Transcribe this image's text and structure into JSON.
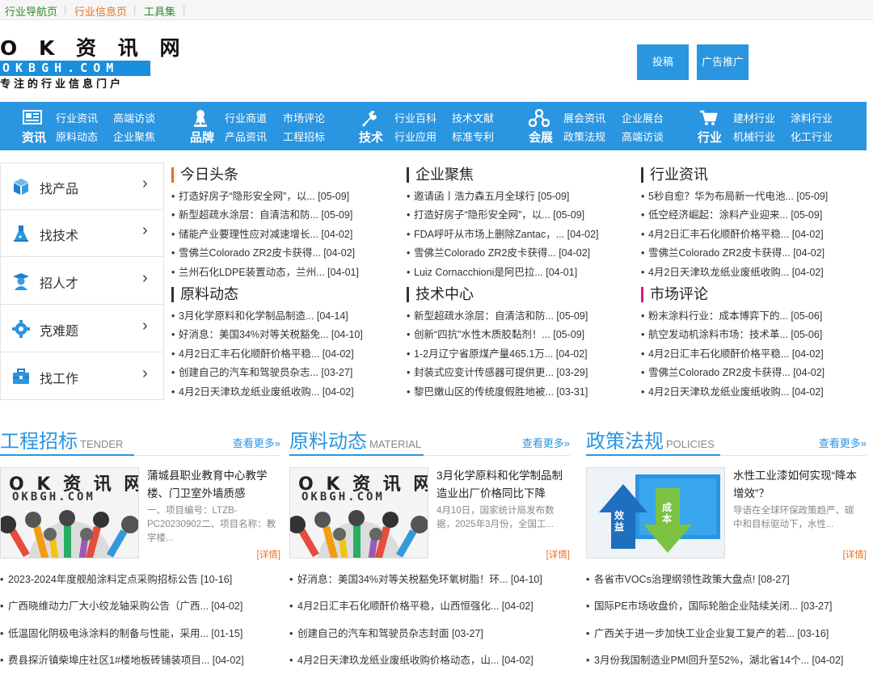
{
  "topbar": {
    "links": [
      "行业导航页",
      "行业信息页",
      "工具集"
    ]
  },
  "logo": {
    "line1": "O K 资 讯 网",
    "line2": "OKBGH.COM",
    "line3": "专注的行业信息门户"
  },
  "header_buttons": [
    "投稿",
    "广告推广"
  ],
  "nav": [
    {
      "category": "资讯",
      "icon": "newspaper-icon",
      "items": [
        "行业资讯",
        "高端访谈",
        "原料动态",
        "企业聚焦"
      ]
    },
    {
      "category": "品牌",
      "icon": "award-icon",
      "items": [
        "行业商道",
        "市场评论",
        "产品资讯",
        "工程招标"
      ]
    },
    {
      "category": "技术",
      "icon": "wrench-icon",
      "items": [
        "行业百科",
        "技术文献",
        "行业应用",
        "标准专利"
      ]
    },
    {
      "category": "会展",
      "icon": "network-icon",
      "items": [
        "展会资讯",
        "企业展台",
        "政策法规",
        "高端访谈"
      ]
    },
    {
      "category": "行业",
      "icon": "cart-icon",
      "items": [
        "建材行业",
        "涂料行业",
        "机械行业",
        "化工行业"
      ]
    }
  ],
  "sidebar": [
    {
      "label": "找产品",
      "icon": "cube-icon"
    },
    {
      "label": "找技术",
      "icon": "flask-icon"
    },
    {
      "label": "招人才",
      "icon": "graduate-icon"
    },
    {
      "label": "克难题",
      "icon": "gear-icon"
    },
    {
      "label": "找工作",
      "icon": "briefcase-icon"
    }
  ],
  "news_blocks": [
    {
      "title": "今日头条",
      "bar": "#e8701e",
      "items": [
        "打造好房子“隐形安全网”，以... [05-09]",
        "新型超疏水涂层：自清洁和防... [05-09]",
        "储能产业要理性应对减速增长... [04-02]",
        "雪佛兰Colorado ZR2皮卡获得... [04-02]",
        "兰州石化LDPE装置动态，兰州... [04-01]"
      ]
    },
    {
      "title": "企业聚焦",
      "bar": "#333333",
      "items": [
        "邀请函丨浩力森五月全球行 [05-09]",
        "打造好房子“隐形安全网”，以... [05-09]",
        "FDA呼吁从市场上删除Zantac，... [04-02]",
        "雪佛兰Colorado ZR2皮卡获得... [04-02]",
        "Luiz Cornacchioni是阿巴拉... [04-01]"
      ]
    },
    {
      "title": "行业资讯",
      "bar": "#333333",
      "items": [
        "5秒自愈？华为布局新一代电池... [05-09]",
        "低空经济崛起：涂料产业迎来... [05-09]",
        "4月2日汇丰石化顺酐价格平稳... [04-02]",
        "雪佛兰Colorado ZR2皮卡获得... [04-02]",
        "4月2日天津玖龙纸业废纸收购... [04-02]"
      ]
    },
    {
      "title": "原料动态",
      "bar": "#333333",
      "items": [
        "3月化学原料和化学制品制造... [04-14]",
        "好消息：美国34%对等关税豁免... [04-10]",
        "4月2日汇丰石化顺酐价格平稳... [04-02]",
        "创建自己的汽车和驾驶员杂志... [03-27]",
        "4月2日天津玖龙纸业废纸收购... [04-02]"
      ]
    },
    {
      "title": "技术中心",
      "bar": "#333333",
      "items": [
        "新型超疏水涂层：自清洁和防... [05-09]",
        "创新“四抗”水性木质胶黏剂！... [05-09]",
        "1-2月辽宁省原煤产量465.1万... [04-02]",
        "封装式应变计传感器可提供更... [03-29]",
        "黎巴嫩山区的传统度假胜地被... [03-31]"
      ]
    },
    {
      "title": "市场评论",
      "bar": "#d6188c",
      "items": [
        "粉末涂料行业：成本博弈下的... [05-06]",
        "航空发动机涂料市场：技术革... [05-06]",
        "4月2日汇丰石化顺酐价格平稳... [04-02]",
        "雪佛兰Colorado ZR2皮卡获得... [04-02]",
        "4月2日天津玖龙纸业废纸收购... [04-02]"
      ]
    }
  ],
  "sections": [
    {
      "title": "工程招标",
      "en": "TENDER",
      "more": "查看更多»",
      "thumb_text": [
        "O K 资 讯 网",
        "OKBGH.COM"
      ],
      "feature_title": "蒲城县职业教育中心教学楼、门卫室外墙质感",
      "feature_desc": "一、项目编号：LTZB-PC20230902二、项目名称：教学楼...",
      "detail": "[详情]",
      "items": [
        "2023-2024年度舰船涂料定点采购招标公告 [10-16]",
        "广西晓维动力厂大小绞龙轴采购公告（广西... [04-02]",
        "低温固化阴极电泳涂料的制备与性能，采用... [01-15]",
        "费县探沂镇柴埠庄社区1#楼地板砖铺装项目... [04-02]"
      ]
    },
    {
      "title": "原料动态",
      "en": "MATERIAL",
      "more": "查看更多»",
      "thumb_text": [
        "O K 资 讯 网",
        "OKBGH.COM"
      ],
      "feature_title": "3月化学原料和化学制品制造业出厂价格同比下降",
      "feature_desc": "4月10日，国家统计局发布数据，2025年3月份，全国工...",
      "detail": "[详情]",
      "items": [
        "好消息：美国34%对等关税豁免环氧树脂！环... [04-10]",
        "4月2日汇丰石化顺酐价格平稳，山西恒强化... [04-02]",
        "创建自己的汽车和驾驶员杂志封面 [03-27]",
        "4月2日天津玖龙纸业废纸收购价格动态，山... [04-02]"
      ]
    },
    {
      "title": "政策法规",
      "en": "POLICIES",
      "more": "查看更多»",
      "thumb_text": [
        "效益",
        "成本"
      ],
      "feature_title": "水性工业漆如何实现“降本增效”？",
      "feature_desc": "导语在全球环保政策趋严、碳中和目标驱动下，水性...",
      "detail": "[详情]",
      "items": [
        "各省市VOCs治理纲领性政策大盘点! [08-27]",
        "国际PE市场收盘价，国际轮胎企业陆续关闭... [03-27]",
        "广西关于进一步加快工业企业复工复产的若... [03-16]",
        "3月份我国制造业PMI回升至52%，湖北省14个... [04-02]"
      ]
    }
  ]
}
